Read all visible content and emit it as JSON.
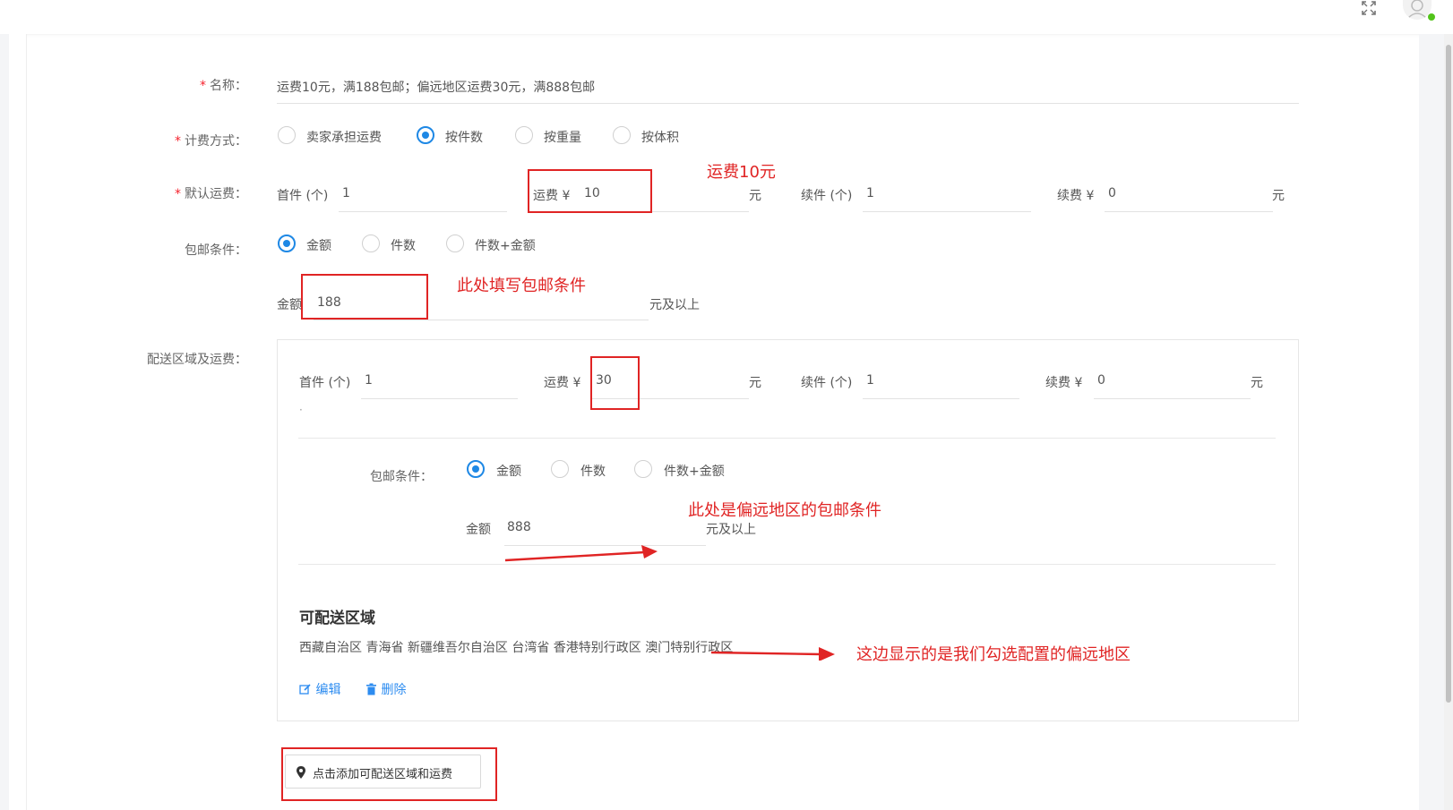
{
  "form": {
    "name_label": "名称：",
    "name_value": "运费10元，满188包邮；偏远地区运费30元，满888包邮",
    "billing_label": "计费方式：",
    "billing_options": [
      "卖家承担运费",
      "按件数",
      "按重量",
      "按体积"
    ],
    "default_fee_label": "默认运费：",
    "first_piece_label": "首件 (个)",
    "first_piece_value": "1",
    "fee_label": "运费 ¥",
    "fee_value": "10",
    "yuan": "元",
    "next_piece_label": "续件 (个)",
    "next_piece_value": "1",
    "next_fee_label": "续费 ¥",
    "next_fee_value": "0",
    "free_cond_label": "包邮条件：",
    "free_cond_options": [
      "金额",
      "件数",
      "件数+金额"
    ],
    "amount_label": "金额",
    "amount_value": "188",
    "amount_suffix": "元及以上",
    "delivery_label": "配送区域及运费："
  },
  "region": {
    "first_piece_label": "首件 (个)",
    "first_piece_value": "1",
    "fee_label": "运费 ¥",
    "fee_value": "30",
    "yuan": "元",
    "next_piece_label": "续件 (个)",
    "next_piece_value": "1",
    "next_fee_label": "续费 ¥",
    "next_fee_value": "0",
    "dot": "·",
    "free_cond_label": "包邮条件：",
    "free_cond_options": [
      "金额",
      "件数",
      "件数+金额"
    ],
    "amount_label": "金额",
    "amount_value": "888",
    "amount_suffix": "元及以上",
    "deliverable_title": "可配送区域",
    "deliverable_areas": "西藏自治区 青海省 新疆维吾尔自治区 台湾省 香港特别行政区 澳门特别行政区",
    "edit_label": "编辑",
    "delete_label": "删除"
  },
  "add_button_label": "点击添加可配送区域和运费",
  "annotations": {
    "fee10": "运费10元",
    "fill_free_cond": "此处填写包邮条件",
    "remote_free_cond": "此处是偏远地区的包邮条件",
    "remote_areas": "这边显示的是我们勾选配置的偏远地区"
  },
  "colors": {
    "accent": "#1e88e5",
    "annotation_red": "#e02424",
    "required_star": "#f5222d",
    "link_blue": "#2d8cf0"
  },
  "icons": [
    "expand-icon",
    "user-avatar-icon",
    "edit-icon",
    "trash-icon",
    "map-pin-icon"
  ]
}
